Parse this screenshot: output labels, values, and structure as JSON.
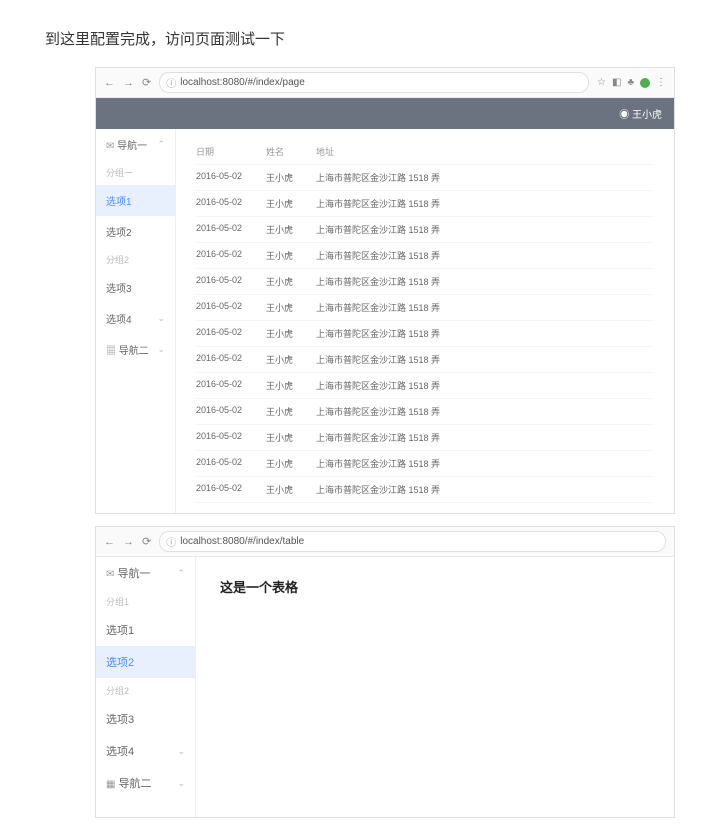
{
  "intro_text": "到这里配置完成，访问页面测试一下",
  "browser1": {
    "url": "localhost:8080/#/index/page",
    "header_user": "王小虎",
    "sidebar": {
      "nav1_label": "导航一",
      "group1_label": "分组一",
      "items": [
        {
          "label": "选项1",
          "active": true
        },
        {
          "label": "选项2",
          "active": false
        }
      ],
      "group2_label": "分组2",
      "items2": [
        {
          "label": "选项3",
          "active": false
        },
        {
          "label": "选项4",
          "active": false
        }
      ],
      "nav2_label": "导航二"
    },
    "table": {
      "headers": {
        "date": "日期",
        "name": "姓名",
        "addr": "地址"
      },
      "rows": [
        {
          "date": "2016-05-02",
          "name": "王小虎",
          "addr": "上海市普陀区金沙江路 1518 弄"
        },
        {
          "date": "2016-05-02",
          "name": "王小虎",
          "addr": "上海市普陀区金沙江路 1518 弄"
        },
        {
          "date": "2016-05-02",
          "name": "王小虎",
          "addr": "上海市普陀区金沙江路 1518 弄"
        },
        {
          "date": "2016-05-02",
          "name": "王小虎",
          "addr": "上海市普陀区金沙江路 1518 弄"
        },
        {
          "date": "2016-05-02",
          "name": "王小虎",
          "addr": "上海市普陀区金沙江路 1518 弄"
        },
        {
          "date": "2016-05-02",
          "name": "王小虎",
          "addr": "上海市普陀区金沙江路 1518 弄"
        },
        {
          "date": "2016-05-02",
          "name": "王小虎",
          "addr": "上海市普陀区金沙江路 1518 弄"
        },
        {
          "date": "2016-05-02",
          "name": "王小虎",
          "addr": "上海市普陀区金沙江路 1518 弄"
        },
        {
          "date": "2016-05-02",
          "name": "王小虎",
          "addr": "上海市普陀区金沙江路 1518 弄"
        },
        {
          "date": "2016-05-02",
          "name": "王小虎",
          "addr": "上海市普陀区金沙江路 1518 弄"
        },
        {
          "date": "2016-05-02",
          "name": "王小虎",
          "addr": "上海市普陀区金沙江路 1518 弄"
        },
        {
          "date": "2016-05-02",
          "name": "王小虎",
          "addr": "上海市普陀区金沙江路 1518 弄"
        },
        {
          "date": "2016-05-02",
          "name": "王小虎",
          "addr": "上海市普陀区金沙江路 1518 弄"
        }
      ]
    }
  },
  "browser2": {
    "url": "localhost:8080/#/index/table",
    "sidebar": {
      "nav1_label": "导航一",
      "group1_label": "分组1",
      "items": [
        {
          "label": "选项1",
          "active": false
        },
        {
          "label": "选项2",
          "active": true
        }
      ],
      "group2_label": "分组2",
      "items2": [
        {
          "label": "选项3",
          "active": false
        },
        {
          "label": "选项4",
          "active": false
        }
      ],
      "nav2_label": "导航二"
    },
    "content_title": "这是一个表格"
  },
  "icons": {
    "info": "ⓘ",
    "star": "☆",
    "bookmark": "🔖",
    "ext": "⋮"
  }
}
